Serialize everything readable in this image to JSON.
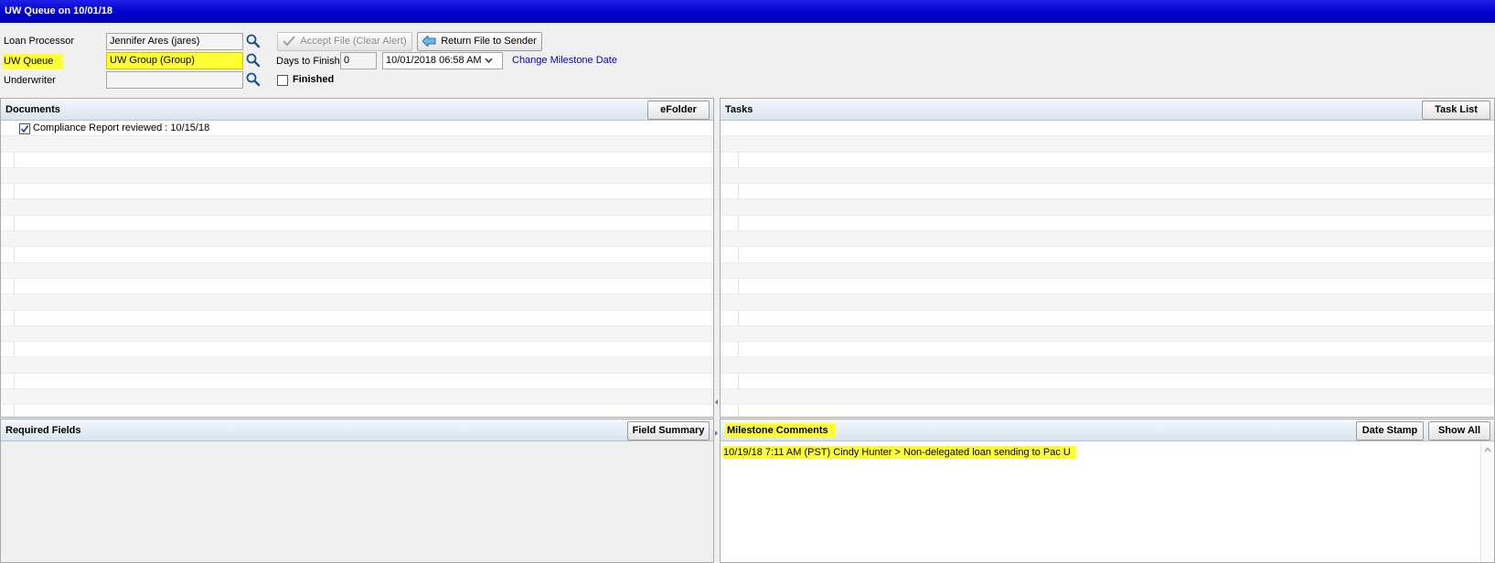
{
  "window": {
    "title": "UW Queue on 10/01/18"
  },
  "form": {
    "loan_processor": {
      "label": "Loan Processor",
      "value": "Jennifer Ares (jares)"
    },
    "uw_queue": {
      "label": "UW Queue",
      "value": "UW Group (Group)"
    },
    "underwriter": {
      "label": "Underwriter",
      "value": ""
    },
    "accept_file_label": "Accept File (Clear Alert)",
    "return_file_label": "Return File to Sender",
    "days_to_finish": {
      "label": "Days to Finish",
      "value": "0"
    },
    "milestone_date": "10/01/2018 06:58 AM",
    "change_milestone_link": "Change Milestone Date",
    "finished_label": "Finished"
  },
  "documents": {
    "title": "Documents",
    "button": "eFolder",
    "items": [
      {
        "label": "Compliance Report  reviewed : 10/15/18",
        "checked": true
      }
    ]
  },
  "tasks": {
    "title": "Tasks",
    "button": "Task List"
  },
  "required_fields": {
    "title": "Required Fields",
    "button": "Field Summary"
  },
  "milestone_comments": {
    "title": "Milestone Comments",
    "date_stamp_label": "Date Stamp",
    "show_all_label": "Show All",
    "text": "10/19/18 7:11 AM (PST) Cindy Hunter > Non-delegated loan sending to Pac U"
  },
  "colors": {
    "title_bar": "#0000d0",
    "highlight": "#ffff33",
    "link": "#0000cc"
  },
  "icons": [
    "magnifier-icon",
    "checkmark-icon",
    "return-arrow-icon",
    "chevron-down-icon",
    "scroll-up-icon"
  ]
}
